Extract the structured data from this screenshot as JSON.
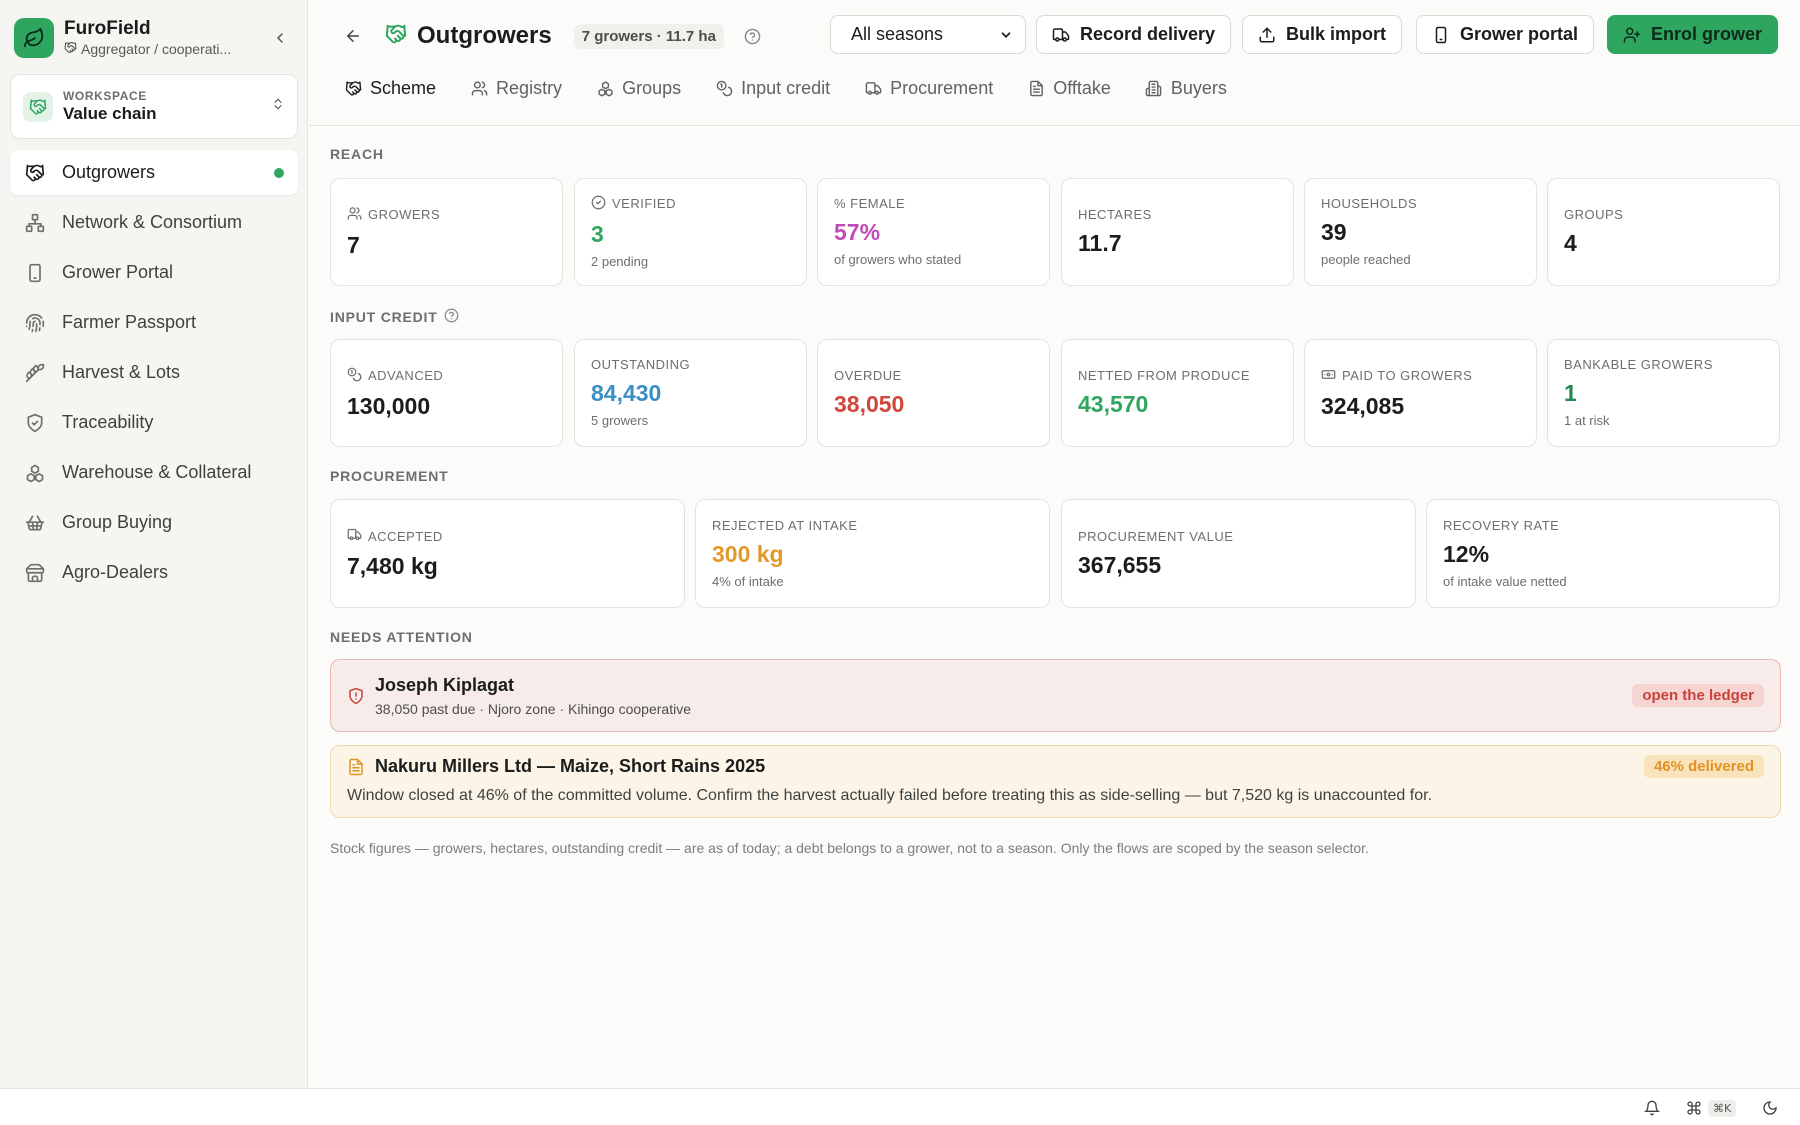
{
  "app": {
    "name": "FuroField",
    "role": "Aggregator / cooperati...",
    "brand_color": "#2ea660"
  },
  "workspace": {
    "label": "WORKSPACE",
    "value": "Value chain"
  },
  "sidebar": {
    "items": [
      {
        "label": "Outgrowers",
        "icon": "handshake-icon",
        "active": true
      },
      {
        "label": "Network & Consortium",
        "icon": "network-icon"
      },
      {
        "label": "Grower Portal",
        "icon": "phone-icon"
      },
      {
        "label": "Farmer Passport",
        "icon": "fingerprint-icon"
      },
      {
        "label": "Harvest & Lots",
        "icon": "wheat-icon"
      },
      {
        "label": "Traceability",
        "icon": "shield-check-icon"
      },
      {
        "label": "Warehouse & Collateral",
        "icon": "boxes-icon"
      },
      {
        "label": "Group Buying",
        "icon": "basket-icon"
      },
      {
        "label": "Agro-Dealers",
        "icon": "store-icon"
      }
    ]
  },
  "header": {
    "title": "Outgrowers",
    "badge": "7 growers · 11.7 ha",
    "season_select": "All seasons",
    "buttons": {
      "record_delivery": "Record delivery",
      "bulk_import": "Bulk import",
      "grower_portal": "Grower portal",
      "enrol_grower": "Enrol grower"
    }
  },
  "tabs": [
    {
      "label": "Scheme",
      "active": true
    },
    {
      "label": "Registry"
    },
    {
      "label": "Groups"
    },
    {
      "label": "Input credit"
    },
    {
      "label": "Procurement"
    },
    {
      "label": "Offtake"
    },
    {
      "label": "Buyers"
    }
  ],
  "reach": {
    "title": "REACH",
    "cards": [
      {
        "label": "GROWERS",
        "value": "7",
        "sub": ""
      },
      {
        "label": "VERIFIED",
        "value": "3",
        "sub": "2 pending"
      },
      {
        "label": "% FEMALE",
        "value": "57%",
        "sub": "of growers who stated"
      },
      {
        "label": "HECTARES",
        "value": "11.7",
        "sub": ""
      },
      {
        "label": "HOUSEHOLDS",
        "value": "39",
        "sub": "people reached"
      },
      {
        "label": "GROUPS",
        "value": "4",
        "sub": ""
      }
    ]
  },
  "input_credit": {
    "title": "INPUT CREDIT",
    "cards": [
      {
        "label": "ADVANCED",
        "value": "130,000",
        "sub": ""
      },
      {
        "label": "OUTSTANDING",
        "value": "84,430",
        "sub": "5 growers"
      },
      {
        "label": "OVERDUE",
        "value": "38,050",
        "sub": ""
      },
      {
        "label": "NETTED FROM PRODUCE",
        "value": "43,570",
        "sub": ""
      },
      {
        "label": "PAID TO GROWERS",
        "value": "324,085",
        "sub": ""
      },
      {
        "label": "BANKABLE GROWERS",
        "value": "1",
        "sub": "1 at risk"
      }
    ]
  },
  "procurement": {
    "title": "PROCUREMENT",
    "cards": [
      {
        "label": "ACCEPTED",
        "value": "7,480 kg",
        "sub": ""
      },
      {
        "label": "REJECTED AT INTAKE",
        "value": "300 kg",
        "sub": "4% of intake"
      },
      {
        "label": "PROCUREMENT VALUE",
        "value": "367,655",
        "sub": ""
      },
      {
        "label": "RECOVERY RATE",
        "value": "12%",
        "sub": "of intake value netted"
      }
    ]
  },
  "attention": {
    "title": "NEEDS ATTENTION",
    "items": [
      {
        "title": "Joseph Kiplagat",
        "sub": "38,050 past due · Njoro zone · Kihingo cooperative",
        "pill": "open the ledger"
      },
      {
        "title": "Nakuru Millers Ltd — Maize, Short Rains 2025",
        "body": "Window closed at 46% of the committed volume. Confirm the harvest actually failed before treating this as side-selling — but 7,520 kg is unaccounted for.",
        "pill": "46% delivered"
      }
    ]
  },
  "footnote": "Stock figures — growers, hectares, outstanding credit — are as of today; a debt belongs to a grower, not to a season. Only the flows are scoped by the season selector.",
  "statusbar": {
    "shortcut": "⌘K"
  }
}
